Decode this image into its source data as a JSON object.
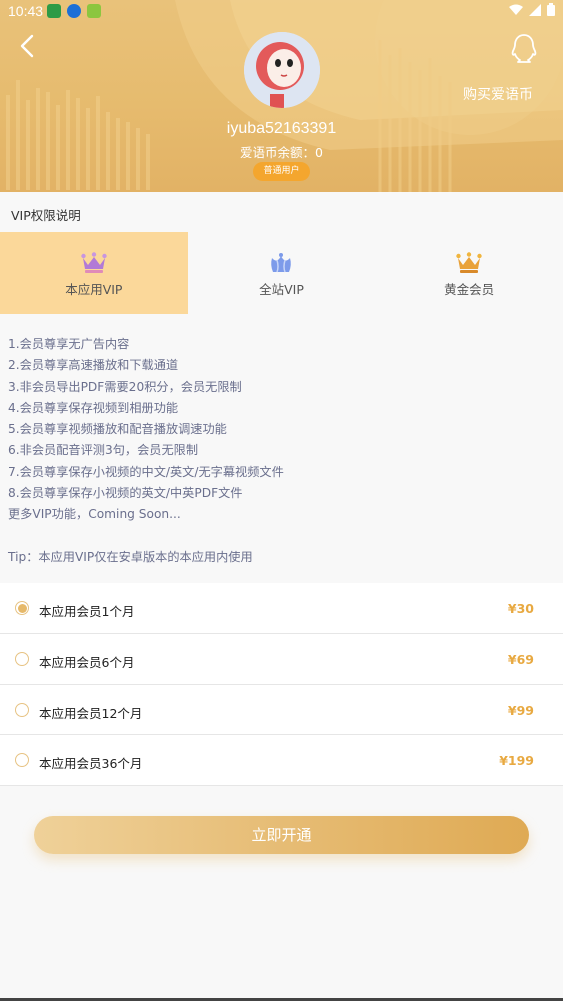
{
  "status_bar": {
    "time": "10:43"
  },
  "header": {
    "buy_coin_label": "购买爱语币",
    "username": "iyuba52163391",
    "balance_label": "爱语币余额：0",
    "user_level": "普通用户"
  },
  "section_title": "VIP权限说明",
  "tabs": [
    {
      "label": "本应用VIP",
      "icon": "crown-purple-icon",
      "active": true
    },
    {
      "label": "全站VIP",
      "icon": "crown-blue-icon",
      "active": false
    },
    {
      "label": "黄金会员",
      "icon": "crown-gold-icon",
      "active": false
    }
  ],
  "features": [
    "1.会员尊享无广告内容",
    "2.会员尊享高速播放和下载通道",
    "3.非会员导出PDF需要20积分，会员无限制",
    "4.会员尊享保存视频到相册功能",
    "5.会员尊享视频播放和配音播放调速功能",
    "6.非会员配音评测3句，会员无限制",
    "7.会员尊享保存小视频的中文/英文/无字幕视频文件",
    "8.会员尊享保存小视频的英文/中英PDF文件",
    "更多VIP功能，Coming Soon..."
  ],
  "tip": "Tip：本应用VIP仅在安卓版本的本应用内使用",
  "plans": [
    {
      "name": "本应用会员1个月",
      "price": "¥30",
      "selected": true
    },
    {
      "name": "本应用会员6个月",
      "price": "¥69",
      "selected": false
    },
    {
      "name": "本应用会员12个月",
      "price": "¥99",
      "selected": false
    },
    {
      "name": "本应用会员36个月",
      "price": "¥199",
      "selected": false
    }
  ],
  "open_button_label": "立即开通",
  "colors": {
    "accent": "#e6b96a",
    "price": "#e8a941",
    "tab_active": "#fbd89a",
    "badge": "#f4a62e"
  }
}
